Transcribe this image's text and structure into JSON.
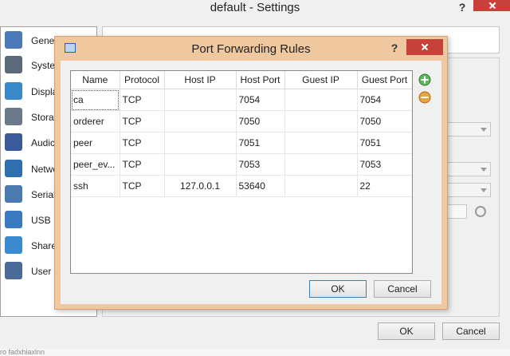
{
  "settings": {
    "title": "default - Settings",
    "help_label": "?",
    "ok_label": "OK",
    "cancel_label": "Cancel",
    "categories": [
      {
        "label": "Gener",
        "icon": "monitor-icon",
        "color": "#4a78b8"
      },
      {
        "label": "Syster",
        "icon": "chip-icon",
        "color": "#5a6a7a"
      },
      {
        "label": "Displa",
        "icon": "display-icon",
        "color": "#3a88c8"
      },
      {
        "label": "Storag",
        "icon": "disk-icon",
        "color": "#6a7a8a"
      },
      {
        "label": "Audic",
        "icon": "speaker-icon",
        "color": "#3a5a9a"
      },
      {
        "label": "Netwo",
        "icon": "network-icon",
        "color": "#2f6fb0"
      },
      {
        "label": "Serial",
        "icon": "serial-port-icon",
        "color": "#4a7ab0"
      },
      {
        "label": "USB",
        "icon": "usb-icon",
        "color": "#3a7ac0"
      },
      {
        "label": "Share",
        "icon": "shared-folder-icon",
        "color": "#3a8ad0"
      },
      {
        "label": "User I",
        "icon": "user-interface-icon",
        "color": "#4a6a9a"
      }
    ],
    "taskbar_text": "ro fadxhiaxlnn"
  },
  "dialog": {
    "title": "Port Forwarding Rules",
    "help_label": "?",
    "ok_label": "OK",
    "cancel_label": "Cancel",
    "columns": [
      "Name",
      "Protocol",
      "Host IP",
      "Host Port",
      "Guest IP",
      "Guest Port"
    ],
    "rows": [
      {
        "name": "ca",
        "protocol": "TCP",
        "host_ip": "",
        "host_port": "7054",
        "guest_ip": "",
        "guest_port": "7054"
      },
      {
        "name": "orderer",
        "protocol": "TCP",
        "host_ip": "",
        "host_port": "7050",
        "guest_ip": "",
        "guest_port": "7050"
      },
      {
        "name": "peer",
        "protocol": "TCP",
        "host_ip": "",
        "host_port": "7051",
        "guest_ip": "",
        "guest_port": "7051"
      },
      {
        "name": "peer_ev...",
        "protocol": "TCP",
        "host_ip": "",
        "host_port": "7053",
        "guest_ip": "",
        "guest_port": "7053"
      },
      {
        "name": "ssh",
        "protocol": "TCP",
        "host_ip": "127.0.0.1",
        "host_port": "53640",
        "guest_ip": "",
        "guest_port": "22"
      }
    ],
    "add_icon": "add-rule-icon",
    "remove_icon": "remove-rule-icon",
    "accent_color": "#f0c8a0"
  }
}
